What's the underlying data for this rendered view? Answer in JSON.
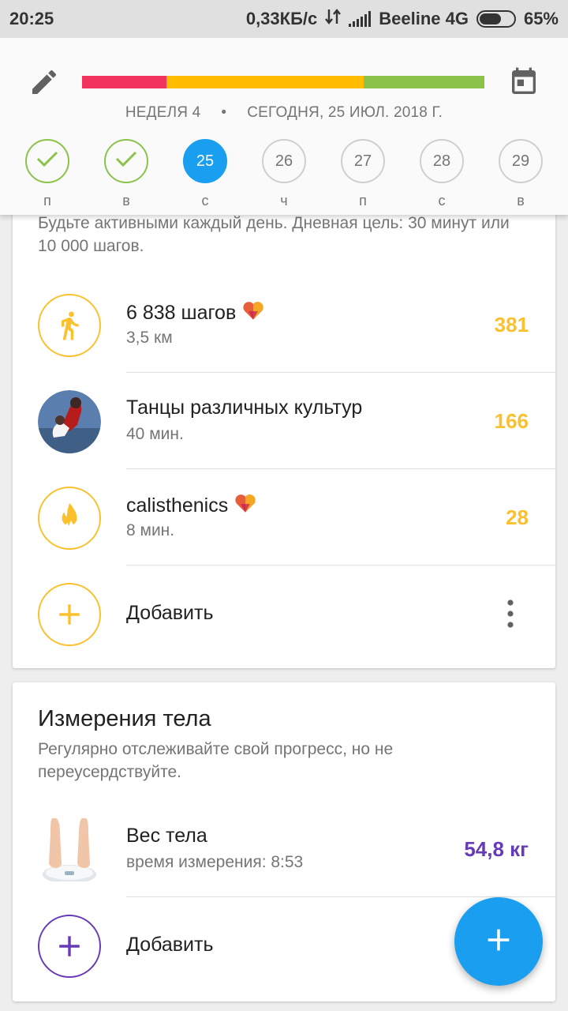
{
  "status_bar": {
    "time": "20:25",
    "speed": "0,33КБ/с",
    "carrier": "Beeline 4G",
    "battery": "65%",
    "battery_level": 0.65
  },
  "header": {
    "progress_segments": [
      {
        "color": "#f0345e",
        "fraction": 0.21
      },
      {
        "color": "#ffbc00",
        "fraction": 0.49
      },
      {
        "color": "#8bc34a",
        "fraction": 0.3
      }
    ],
    "week_label": "НЕДЕЛЯ 4",
    "separator": "•",
    "today_label": "СЕГОДНЯ, 25 ИЮЛ. 2018 Г.",
    "days": [
      {
        "number": "",
        "weekday": "п",
        "state": "done"
      },
      {
        "number": "",
        "weekday": "в",
        "state": "done"
      },
      {
        "number": "25",
        "weekday": "с",
        "state": "today"
      },
      {
        "number": "26",
        "weekday": "ч",
        "state": "future"
      },
      {
        "number": "27",
        "weekday": "п",
        "state": "future"
      },
      {
        "number": "28",
        "weekday": "с",
        "state": "future"
      },
      {
        "number": "29",
        "weekday": "в",
        "state": "future"
      }
    ]
  },
  "activity_card": {
    "description": "Будьте активными каждый день. Дневная цель: 30 минут или 10 000 шагов.",
    "items": [
      {
        "title": "6 838 шагов",
        "subtitle": "3,5 км",
        "value": "381",
        "icon": "walking-icon",
        "has_heart": true
      },
      {
        "title": "Танцы различных культур",
        "subtitle": "40 мин.",
        "value": "166",
        "icon": "dance-photo",
        "has_heart": false
      },
      {
        "title": "calisthenics",
        "subtitle": "8 мин.",
        "value": "28",
        "icon": "flame-icon",
        "has_heart": true
      }
    ],
    "add_label": "Добавить"
  },
  "body_card": {
    "title": "Измерения тела",
    "description": "Регулярно отслеживайте свой прогресс, но не переусердствуйте.",
    "item": {
      "title": "Вес тела",
      "subtitle": "время измерения: 8:53",
      "value": "54,8 кг"
    },
    "add_label": "Добавить"
  },
  "colors": {
    "accent_blue": "#1a9ff0",
    "activity_yellow": "#fbc02d",
    "body_purple": "#673ab7",
    "done_green": "#8bc34a"
  }
}
